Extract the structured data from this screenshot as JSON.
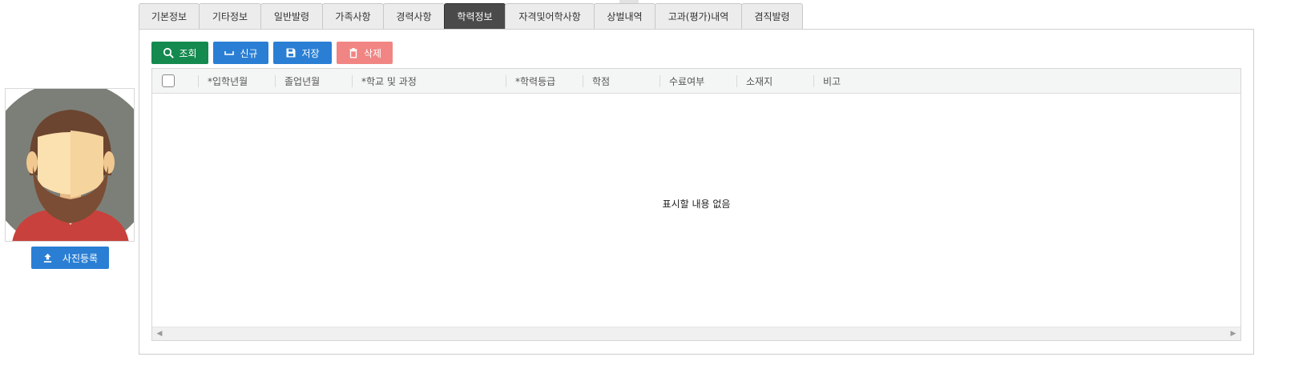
{
  "tabs": [
    {
      "label": "기본정보",
      "active": false
    },
    {
      "label": "기타정보",
      "active": false
    },
    {
      "label": "일반발령",
      "active": false
    },
    {
      "label": "가족사항",
      "active": false
    },
    {
      "label": "경력사항",
      "active": false
    },
    {
      "label": "학력정보",
      "active": true
    },
    {
      "label": "자격및어학사항",
      "active": false
    },
    {
      "label": "상벌내역",
      "active": false
    },
    {
      "label": "고과(평가)내역",
      "active": false
    },
    {
      "label": "겸직발령",
      "active": false
    }
  ],
  "photo": {
    "upload_label": "사진등록",
    "upload_icon": "upload-icon"
  },
  "toolbar": {
    "search_label": "조회",
    "new_label": "신규",
    "save_label": "저장",
    "delete_label": "삭제"
  },
  "grid": {
    "columns": [
      "*입학년월",
      "졸업년월",
      "*학교 및 과정",
      "*학력등급",
      "학점",
      "수료여부",
      "소재지",
      "비고"
    ],
    "rows": [],
    "empty_message": "표시할 내용 없음"
  },
  "colors": {
    "search": "#148a4f",
    "primary": "#2a7fd4",
    "delete": "#f08583",
    "active_tab": "#4a4a4a"
  }
}
